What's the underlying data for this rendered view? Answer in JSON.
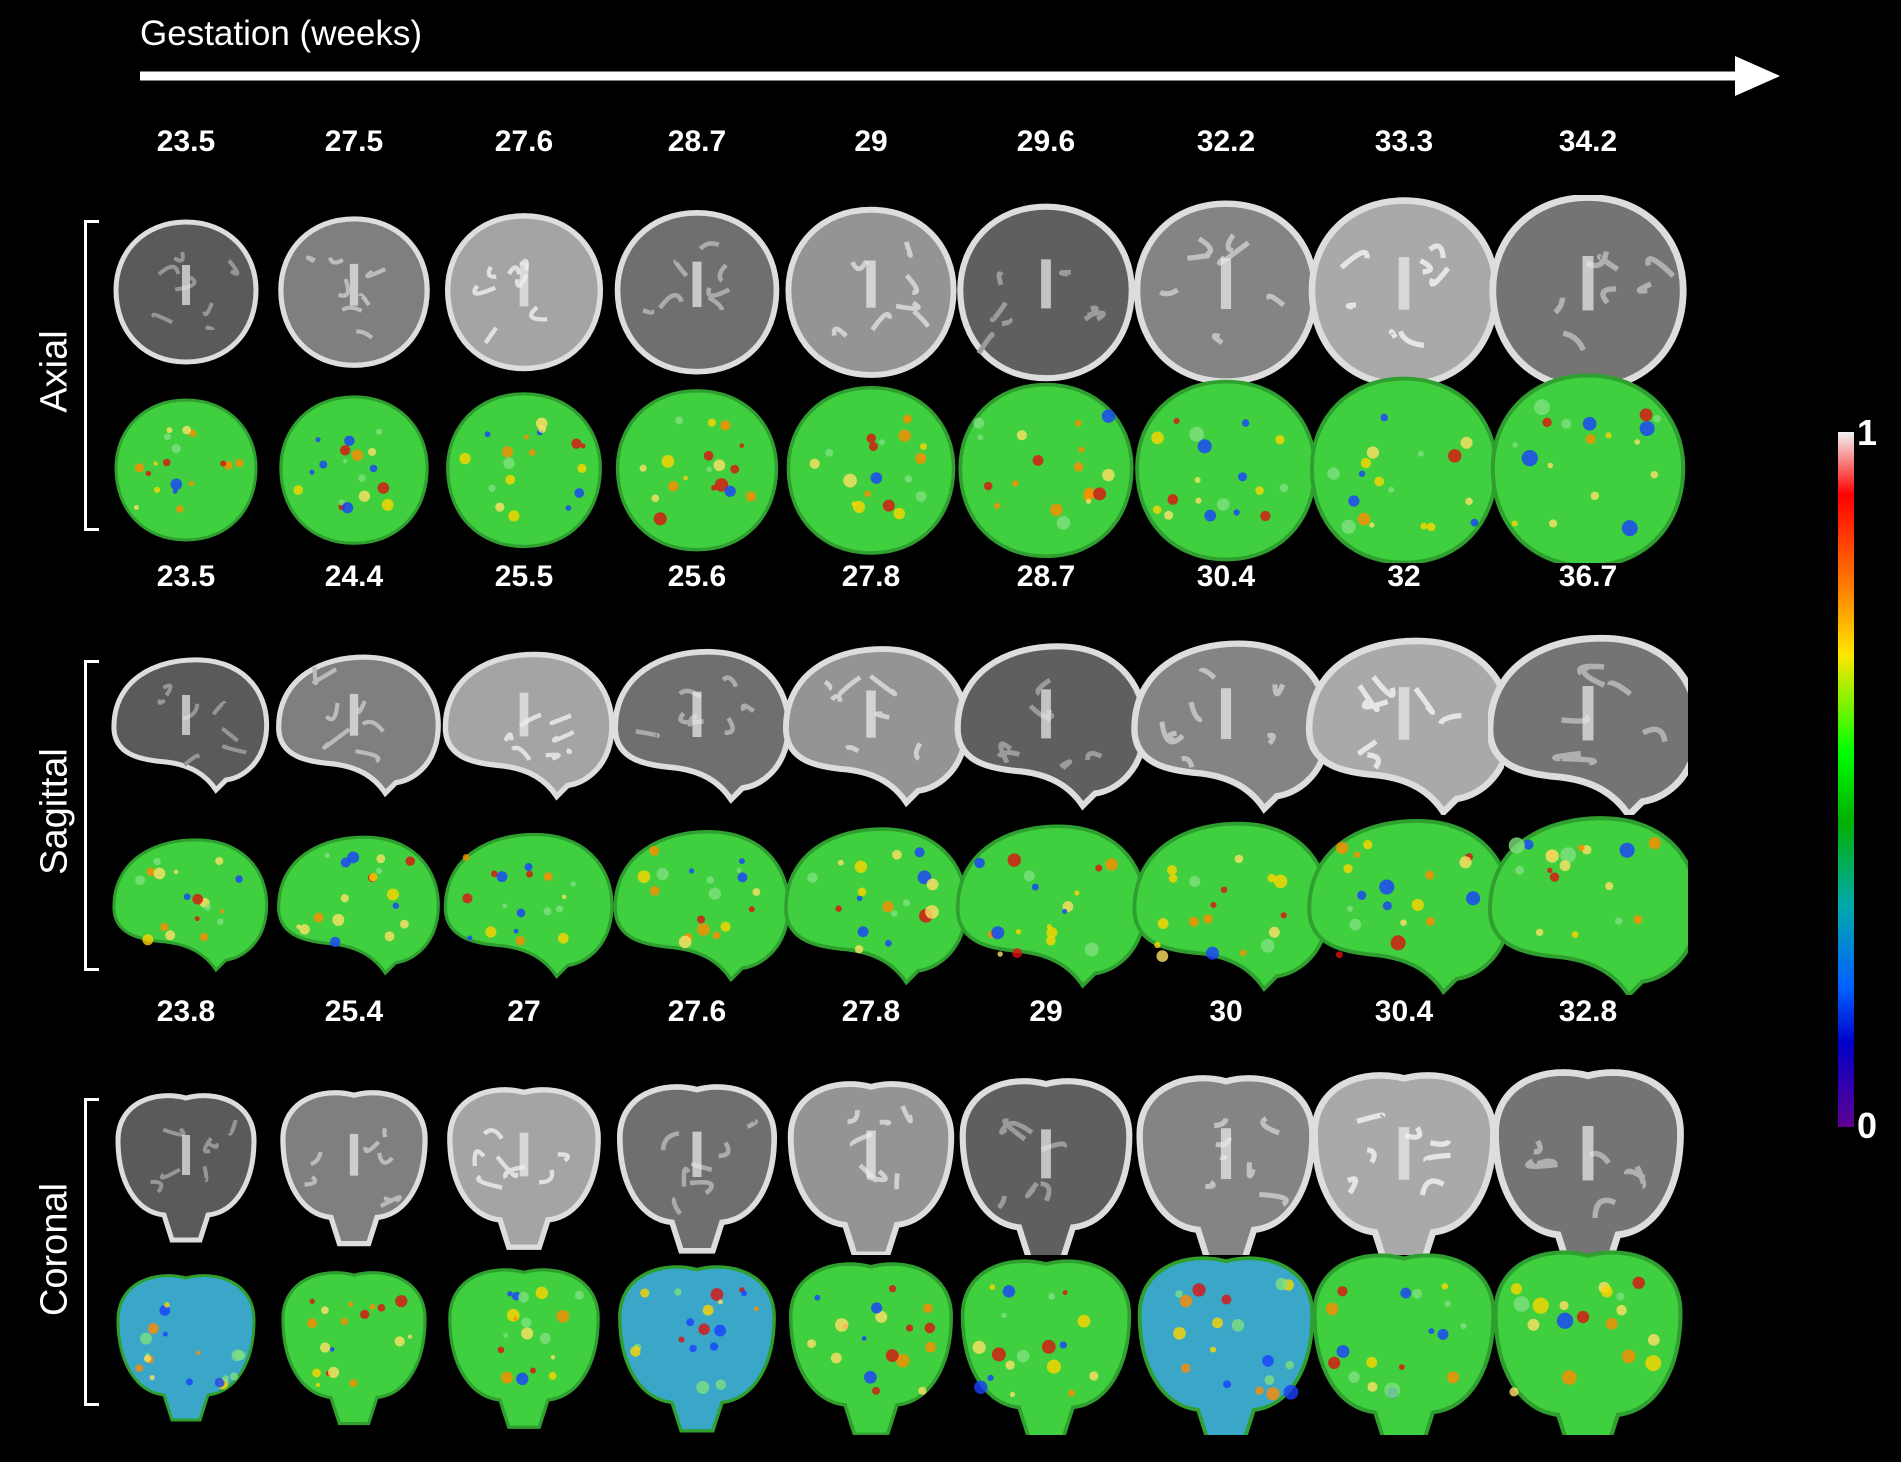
{
  "figure": {
    "axis_title": "Gestation (weeks)",
    "colorbar": {
      "max_label": "1",
      "min_label": "0"
    },
    "rows": [
      {
        "plane": "Axial",
        "shape": "axial",
        "ages": [
          "23.5",
          "27.5",
          "27.6",
          "28.7",
          "29",
          "29.6",
          "32.2",
          "33.3",
          "34.2"
        ]
      },
      {
        "plane": "Sagittal",
        "shape": "sagittal",
        "ages": [
          "23.5",
          "24.4",
          "25.5",
          "25.6",
          "27.8",
          "28.7",
          "30.4",
          "32",
          "36.7"
        ]
      },
      {
        "plane": "Coronal",
        "shape": "coronal",
        "ages": [
          "23.8",
          "25.4",
          "27",
          "27.6",
          "27.8",
          "29",
          "30",
          "30.4",
          "32.8"
        ]
      }
    ]
  }
}
